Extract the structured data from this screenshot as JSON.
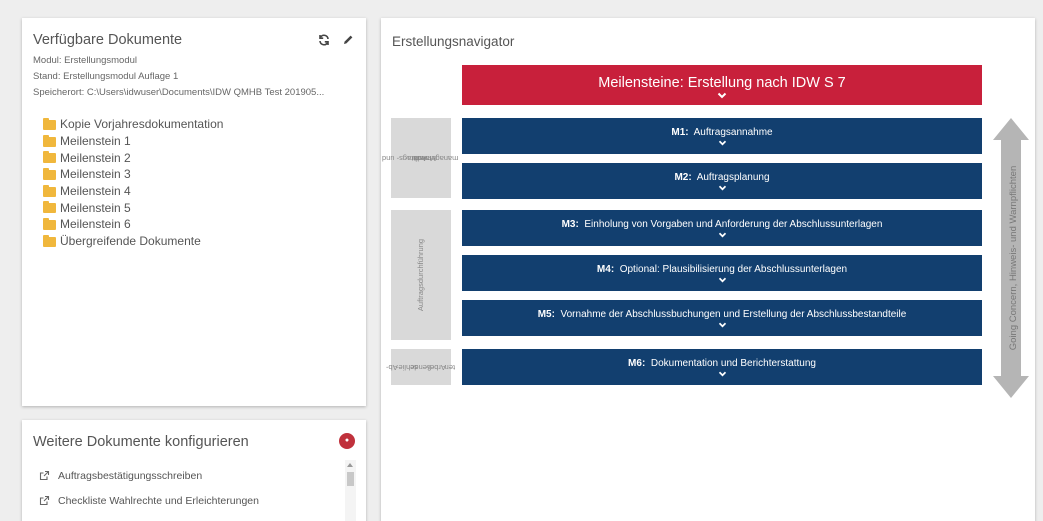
{
  "available_docs": {
    "title": "Verfügbare Dokumente",
    "modul": "Modul: Erstellungsmodul",
    "stand": "Stand: Erstellungsmodul Auflage 1",
    "speicherort": "Speicherort: C:\\Users\\idwuser\\Documents\\IDW QMHB Test 201905...",
    "folders": [
      "Kopie Vorjahresdokumentation",
      "Meilenstein 1",
      "Meilenstein 2",
      "Meilenstein 3",
      "Meilenstein 4",
      "Meilenstein 5",
      "Meilenstein 6",
      "Übergreifende Dokumente"
    ]
  },
  "configure": {
    "title": "Weitere Dokumente konfigurieren",
    "items": [
      "Auftragsbestätigungsschreiben",
      "Checkliste Wahlrechte und Erleichterungen"
    ]
  },
  "navigator": {
    "title": "Erstellungsnavigator",
    "banner": "Meilensteine: Erstellung nach IDW S 7",
    "milestones": [
      {
        "code": "M1:",
        "label": "Auftragsannahme"
      },
      {
        "code": "M2:",
        "label": "Auftragsplanung"
      },
      {
        "code": "M3:",
        "label": "Einholung von Vorgaben und Anforderung der Abschlussunterlagen"
      },
      {
        "code": "M4:",
        "label": "Optional: Plausibilisierung der Abschlussunterlagen"
      },
      {
        "code": "M5:",
        "label": "Vornahme der Abschlussbuchungen und Erstellung der Abschlussbestandteile"
      },
      {
        "code": "M6:",
        "label": "Dokumentation und Berichterstattung"
      }
    ],
    "phases": [
      {
        "line1": "Auftrags- und",
        "line2": "Mandats-",
        "line3": "management"
      },
      {
        "line1": "Auftragsdurchführung"
      },
      {
        "line1": "Ab-",
        "line2": "schlie-",
        "line3": "ßende",
        "line4": "Arbei-",
        "line5": "ten"
      }
    ],
    "side_label": "Going Concern, Hinweis- und Warnpflichten",
    "colors": {
      "banner": "#c8203b",
      "milestone": "#123f6f",
      "phase": "#d9d9d9",
      "arrow": "#b5b5b5"
    }
  }
}
